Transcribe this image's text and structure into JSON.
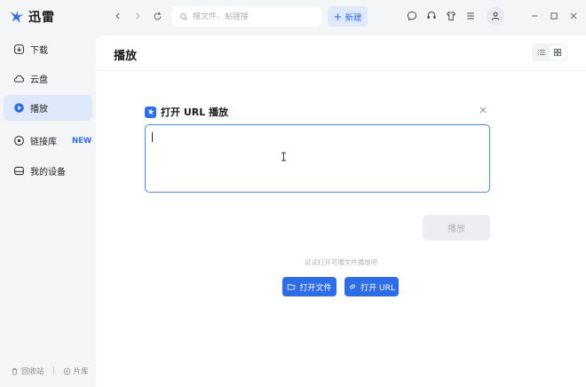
{
  "app": {
    "name": "迅雷"
  },
  "header": {
    "search_placeholder": "搜文件、贴链接",
    "new_label": "新建"
  },
  "sidebar": {
    "items": [
      {
        "label": "下载",
        "icon": "download-icon"
      },
      {
        "label": "云盘",
        "icon": "cloud-icon"
      },
      {
        "label": "播放",
        "icon": "play-icon",
        "active": true
      },
      {
        "label": "链接库",
        "icon": "link-library-icon",
        "badge": "NEW"
      },
      {
        "label": "我的设备",
        "icon": "device-icon"
      }
    ],
    "footer": [
      {
        "label": "回收站",
        "icon": "trash-icon"
      },
      {
        "label": "片库",
        "icon": "film-library-icon"
      }
    ]
  },
  "main": {
    "title": "播放",
    "dialog": {
      "title": "打开 URL 播放",
      "url_value": "",
      "play_label": "播放",
      "hint": "试试打开可播文件播放吧",
      "open_file_label": "打开文件",
      "open_url_label": "打开 URL"
    }
  },
  "colors": {
    "accent": "#2e6de6",
    "accent_light": "#dfe9fb",
    "sidebar_bg": "#f4f5f7"
  }
}
